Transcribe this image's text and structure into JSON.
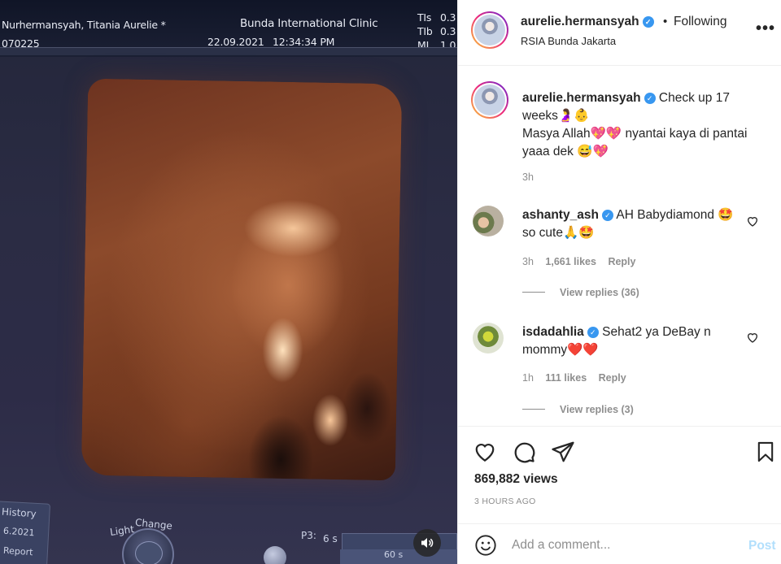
{
  "ultrasound": {
    "patient": "Nurhermansyah, Titania Aurelie *",
    "clinic": "Bunda International Clinic",
    "id": "070225",
    "date": "22.09.2021",
    "time": "12:34:34 PM",
    "tis_label": "TIs",
    "tis_value": "0.3",
    "tib_label": "TIb",
    "tib_value": "0.3",
    "mi_label": "MI",
    "mi_value": "1.0",
    "history": "History",
    "history_date": "6.2021",
    "report": "Report",
    "light": "Light",
    "change": "Change",
    "p3": "P3:",
    "seconds": "6 s",
    "seconds2": "60 s"
  },
  "post": {
    "username": "aurelie.hermansyah",
    "following_label": "Following",
    "location": "RSIA Bunda Jakarta",
    "more_label": "•••",
    "caption_line1": "Check up 17 weeks🤰👶",
    "caption_line2": "Masya Allah💖💖 nyantai kaya di pantai yaaa dek 😅💖",
    "caption_time": "3h",
    "views": "869,882 views",
    "posted_ago": "3 HOURS AGO"
  },
  "comments": [
    {
      "username": "ashanty_ash",
      "text": "AH Babydiamond 🤩 so cute🙏🤩",
      "time": "3h",
      "likes": "1,661 likes",
      "reply": "Reply",
      "view_replies": "View replies (36)"
    },
    {
      "username": "isdadahlia",
      "text": "Sehat2 ya DeBay n mommy❤️❤️",
      "time": "1h",
      "likes": "111 likes",
      "reply": "Reply",
      "view_replies": "View replies (3)"
    }
  ],
  "add_comment": {
    "placeholder": "Add a comment...",
    "post_label": "Post"
  },
  "colors": {
    "verified": "#3897f0",
    "post_disabled": "#b2dffc",
    "secondary_text": "#8e8e8e"
  }
}
